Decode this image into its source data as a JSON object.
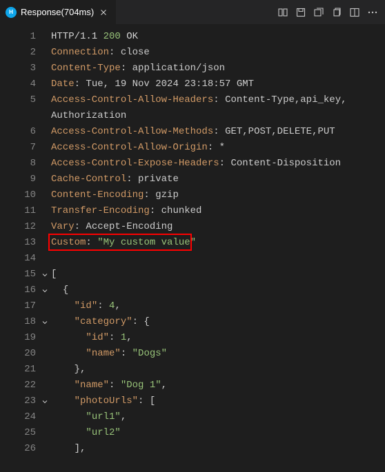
{
  "tab": {
    "title": "Response(704ms)",
    "icon_label": "http"
  },
  "lines": [
    {
      "n": 1,
      "fold": "",
      "segs": [
        [
          "http",
          "HTTP/1.1 "
        ],
        [
          "status",
          "200"
        ],
        [
          "http",
          " OK"
        ]
      ]
    },
    {
      "n": 2,
      "fold": "",
      "segs": [
        [
          "key",
          "Connection"
        ],
        [
          "punc",
          ": "
        ],
        [
          "plain",
          "close"
        ]
      ]
    },
    {
      "n": 3,
      "fold": "",
      "segs": [
        [
          "key",
          "Content-Type"
        ],
        [
          "punc",
          ": "
        ],
        [
          "plain",
          "application/json"
        ]
      ]
    },
    {
      "n": 4,
      "fold": "",
      "segs": [
        [
          "key",
          "Date"
        ],
        [
          "punc",
          ": "
        ],
        [
          "plain",
          "Tue, 19 Nov 2024 23:18:57 GMT"
        ]
      ]
    },
    {
      "n": 5,
      "fold": "",
      "segs": [
        [
          "key",
          "Access-Control-Allow-Headers"
        ],
        [
          "punc",
          ": "
        ],
        [
          "plain",
          "Content-Type,api_key,"
        ]
      ]
    },
    {
      "n": "",
      "fold": "",
      "segs": [
        [
          "plain",
          "Authorization"
        ]
      ]
    },
    {
      "n": 6,
      "fold": "",
      "segs": [
        [
          "key",
          "Access-Control-Allow-Methods"
        ],
        [
          "punc",
          ": "
        ],
        [
          "plain",
          "GET,POST,DELETE,PUT"
        ]
      ]
    },
    {
      "n": 7,
      "fold": "",
      "segs": [
        [
          "key",
          "Access-Control-Allow-Origin"
        ],
        [
          "punc",
          ": "
        ],
        [
          "plain",
          "*"
        ]
      ]
    },
    {
      "n": 8,
      "fold": "",
      "segs": [
        [
          "key",
          "Access-Control-Expose-Headers"
        ],
        [
          "punc",
          ": "
        ],
        [
          "plain",
          "Content-Disposition"
        ]
      ]
    },
    {
      "n": 9,
      "fold": "",
      "segs": [
        [
          "key",
          "Cache-Control"
        ],
        [
          "punc",
          ": "
        ],
        [
          "plain",
          "private"
        ]
      ]
    },
    {
      "n": 10,
      "fold": "",
      "segs": [
        [
          "key",
          "Content-Encoding"
        ],
        [
          "punc",
          ": "
        ],
        [
          "plain",
          "gzip"
        ]
      ]
    },
    {
      "n": 11,
      "fold": "",
      "segs": [
        [
          "key",
          "Transfer-Encoding"
        ],
        [
          "punc",
          ": "
        ],
        [
          "plain",
          "chunked"
        ]
      ]
    },
    {
      "n": 12,
      "fold": "",
      "segs": [
        [
          "key",
          "Vary"
        ],
        [
          "punc",
          ": "
        ],
        [
          "plain",
          "Accept-Encoding"
        ]
      ]
    },
    {
      "n": 13,
      "fold": "",
      "hl": true,
      "hlw": 208,
      "segs": [
        [
          "key",
          "Custom"
        ],
        [
          "punc",
          ": "
        ],
        [
          "str",
          "\"My custom value\""
        ]
      ]
    },
    {
      "n": 14,
      "fold": "",
      "segs": []
    },
    {
      "n": 15,
      "fold": "v",
      "segs": [
        [
          "punc",
          "["
        ]
      ]
    },
    {
      "n": 16,
      "fold": "v",
      "segs": [
        [
          "plain",
          "  "
        ],
        [
          "punc",
          "{"
        ]
      ]
    },
    {
      "n": 17,
      "fold": "",
      "segs": [
        [
          "plain",
          "    "
        ],
        [
          "key",
          "\"id\""
        ],
        [
          "punc",
          ": "
        ],
        [
          "num",
          "4"
        ],
        [
          "punc",
          ","
        ]
      ]
    },
    {
      "n": 18,
      "fold": "v",
      "segs": [
        [
          "plain",
          "    "
        ],
        [
          "key",
          "\"category\""
        ],
        [
          "punc",
          ": {"
        ]
      ]
    },
    {
      "n": 19,
      "fold": "",
      "segs": [
        [
          "plain",
          "      "
        ],
        [
          "key",
          "\"id\""
        ],
        [
          "punc",
          ": "
        ],
        [
          "num",
          "1"
        ],
        [
          "punc",
          ","
        ]
      ]
    },
    {
      "n": 20,
      "fold": "",
      "segs": [
        [
          "plain",
          "      "
        ],
        [
          "key",
          "\"name\""
        ],
        [
          "punc",
          ": "
        ],
        [
          "str",
          "\"Dogs\""
        ]
      ]
    },
    {
      "n": 21,
      "fold": "",
      "segs": [
        [
          "plain",
          "    "
        ],
        [
          "punc",
          "},"
        ]
      ]
    },
    {
      "n": 22,
      "fold": "",
      "segs": [
        [
          "plain",
          "    "
        ],
        [
          "key",
          "\"name\""
        ],
        [
          "punc",
          ": "
        ],
        [
          "str",
          "\"Dog 1\""
        ],
        [
          "punc",
          ","
        ]
      ]
    },
    {
      "n": 23,
      "fold": "v",
      "segs": [
        [
          "plain",
          "    "
        ],
        [
          "key",
          "\"photoUrls\""
        ],
        [
          "punc",
          ": ["
        ]
      ]
    },
    {
      "n": 24,
      "fold": "",
      "segs": [
        [
          "plain",
          "      "
        ],
        [
          "str",
          "\"url1\""
        ],
        [
          "punc",
          ","
        ]
      ]
    },
    {
      "n": 25,
      "fold": "",
      "segs": [
        [
          "plain",
          "      "
        ],
        [
          "str",
          "\"url2\""
        ]
      ]
    },
    {
      "n": 26,
      "fold": "",
      "segs": [
        [
          "plain",
          "    "
        ],
        [
          "punc",
          "],"
        ]
      ]
    }
  ]
}
